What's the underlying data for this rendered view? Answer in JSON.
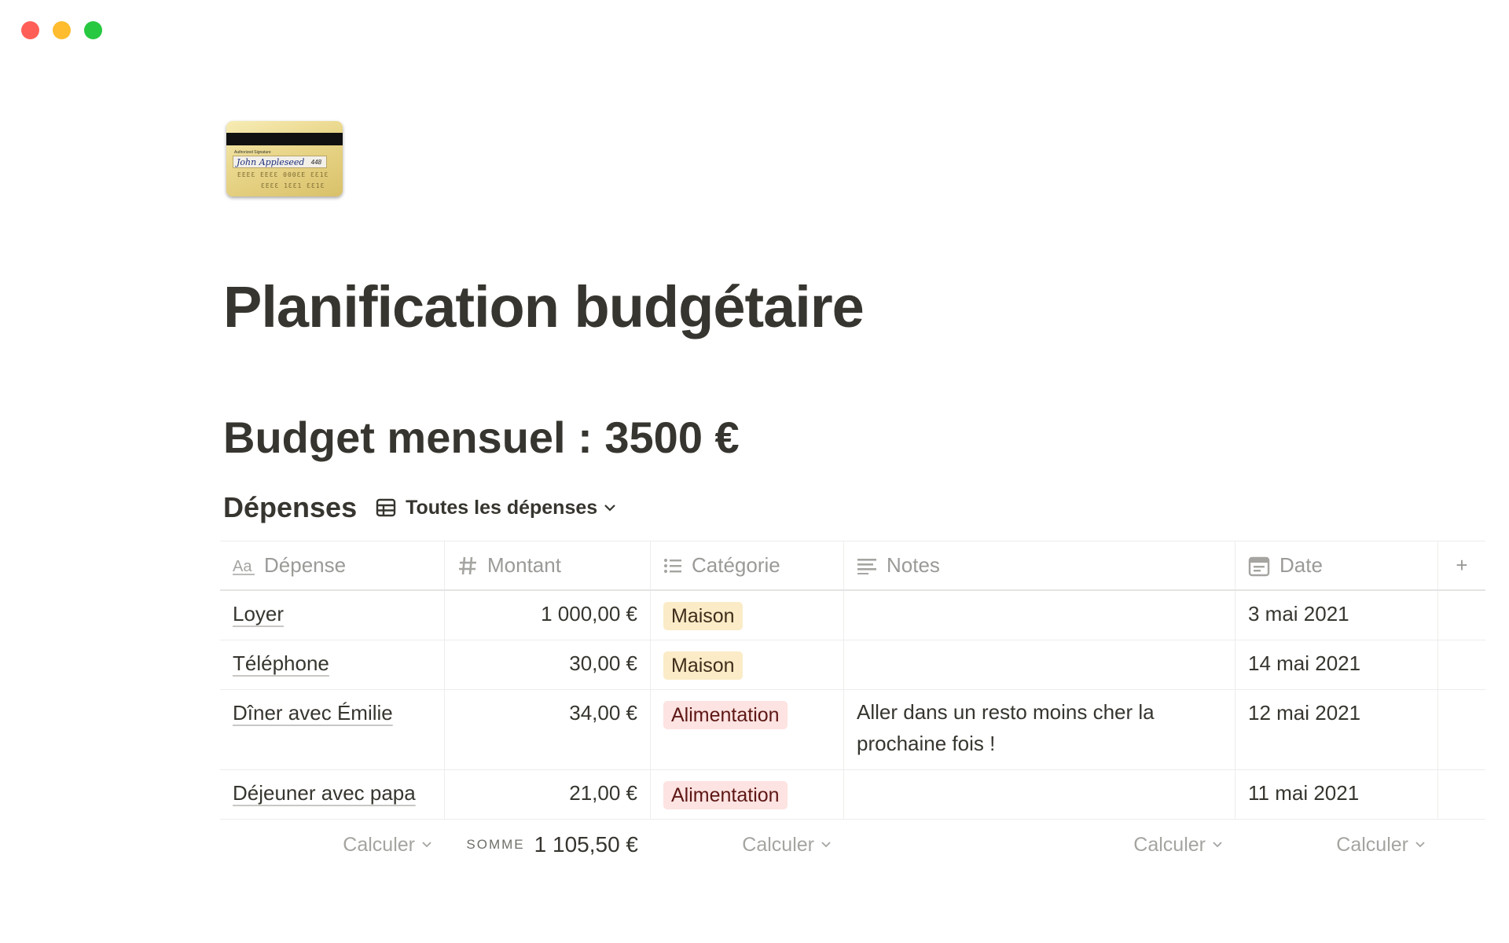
{
  "window": {
    "controls": [
      "close",
      "minimize",
      "zoom"
    ]
  },
  "page": {
    "icon": "credit-card-icon",
    "icon_text": {
      "label": "Authorized Signature",
      "signature": "John Appleseed",
      "cvv": "448",
      "number_1": "EEEƐ EEƐƐ 000ƐE ƐƐ1Ɛ",
      "number_2": "ƐEƐƐ 1ƐƐ1 ƐƐ1Ɛ"
    },
    "title": "Planification budgétaire",
    "heading": "Budget mensuel : 3500 €"
  },
  "database": {
    "title": "Dépenses",
    "view": {
      "label": "Toutes les dépenses",
      "icon": "table-icon"
    },
    "columns": [
      {
        "label": "Dépense",
        "icon": "text-icon"
      },
      {
        "label": "Montant",
        "icon": "number-icon"
      },
      {
        "label": "Catégorie",
        "icon": "list-icon"
      },
      {
        "label": "Notes",
        "icon": "notes-icon"
      },
      {
        "label": "Date",
        "icon": "calendar-icon"
      }
    ],
    "add_column": "+",
    "rows": [
      {
        "depense": "Loyer",
        "montant": "1 000,00 €",
        "categorie": "Maison",
        "notes": "",
        "date": "3 mai 2021"
      },
      {
        "depense": "Téléphone",
        "montant": "30,00 €",
        "categorie": "Maison",
        "notes": "",
        "date": "14 mai 2021"
      },
      {
        "depense": "Dîner avec Émilie",
        "montant": "34,00 €",
        "categorie": "Alimentation",
        "notes": "Aller dans un resto moins cher la prochaine fois !",
        "date": "12 mai 2021"
      },
      {
        "depense": "Déjeuner avec papa",
        "montant": "21,00 €",
        "categorie": "Alimentation",
        "notes": "",
        "date": "11 mai 2021"
      }
    ],
    "footer": {
      "calc_label": "Calculer",
      "sum_label": "SOMME",
      "sum_value": "1 105,50 €"
    },
    "colors": {
      "maison_tag": "#fbecc7",
      "alimentation_tag": "#fde3e1"
    }
  }
}
